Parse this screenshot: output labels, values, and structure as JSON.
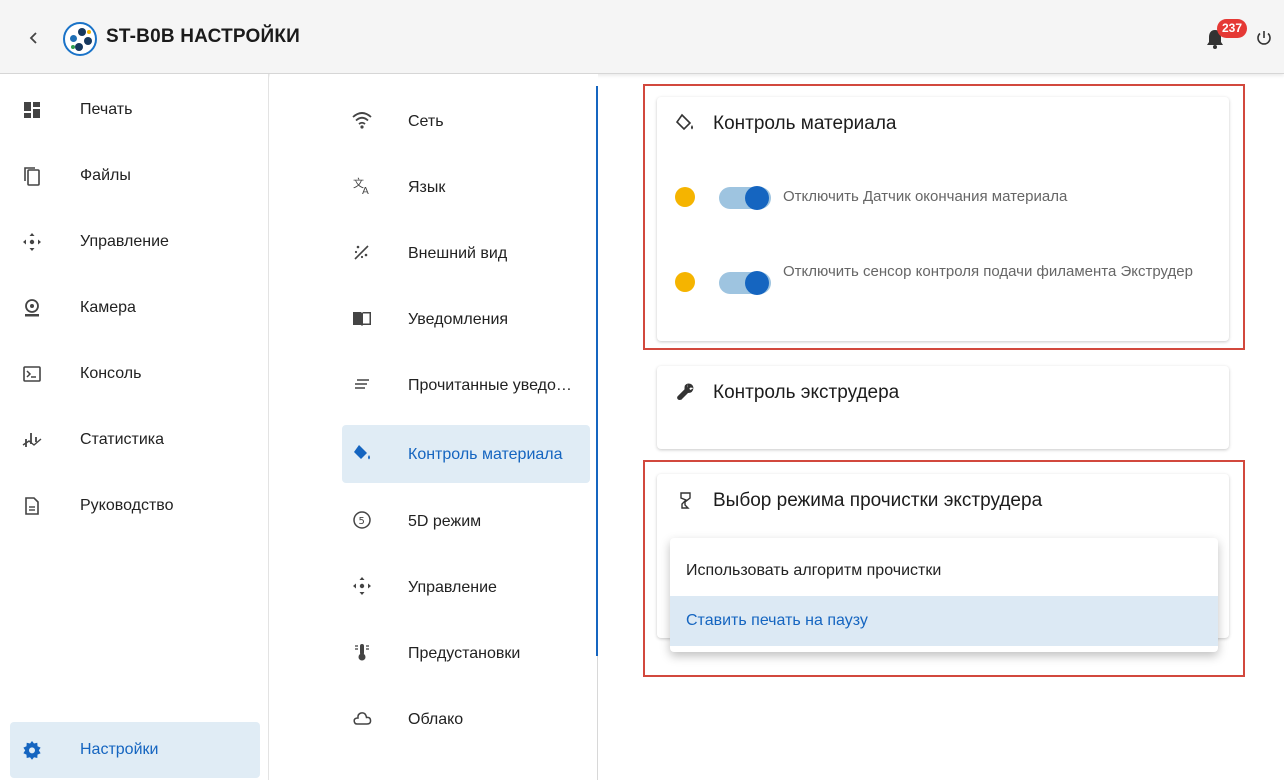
{
  "header": {
    "back_icon": "chevron-left-icon",
    "title": "ST-B0B НАСТРОЙКИ",
    "notification_count": "237",
    "badge_color": "#e53935"
  },
  "nav": {
    "items": [
      {
        "label": "Печать",
        "icon": "dashboard-icon"
      },
      {
        "label": "Файлы",
        "icon": "files-icon"
      },
      {
        "label": "Управление",
        "icon": "move-arrows-icon"
      },
      {
        "label": "Камера",
        "icon": "webcam-icon"
      },
      {
        "label": "Консоль",
        "icon": "console-icon"
      },
      {
        "label": "Статистика",
        "icon": "chart-icon"
      },
      {
        "label": "Руководство",
        "icon": "document-icon"
      }
    ],
    "settings_label": "Настройки"
  },
  "submenu": {
    "items": [
      {
        "label": "Сеть",
        "icon": "wifi-icon"
      },
      {
        "label": "Язык",
        "icon": "translate-icon"
      },
      {
        "label": "Внешний вид",
        "icon": "theme-icon"
      },
      {
        "label": "Уведомления",
        "icon": "book-icon"
      },
      {
        "label": "Прочитанные уведомления",
        "icon": "list-icon"
      },
      {
        "label": "Контроль материала",
        "icon": "paint-bucket-icon"
      },
      {
        "label": "5D режим",
        "icon": "number-five-icon"
      },
      {
        "label": "Управление",
        "icon": "move-arrows-icon"
      },
      {
        "label": "Предустановки",
        "icon": "thermometer-icon"
      },
      {
        "label": "Облако",
        "icon": "cloud-icon"
      }
    ],
    "active_index": 5
  },
  "material_control": {
    "title": "Контроль материала",
    "toggles": [
      {
        "label": "Отключить Датчик окончания материала",
        "on": true
      },
      {
        "label": "Отключить сенсор контроля подачи филамента Экструдер",
        "on": true
      }
    ]
  },
  "extruder_control": {
    "title": "Контроль экструдера"
  },
  "purge_mode": {
    "title": "Выбор режима прочистки экструдера",
    "options": [
      {
        "label": "Использовать алгоритм прочистки"
      },
      {
        "label": "Ставить печать на паузу"
      }
    ],
    "selected_index": 1
  },
  "colors": {
    "accent": "#1565c0",
    "highlight_border": "#d2483d",
    "status_dot": "#f5b400"
  }
}
